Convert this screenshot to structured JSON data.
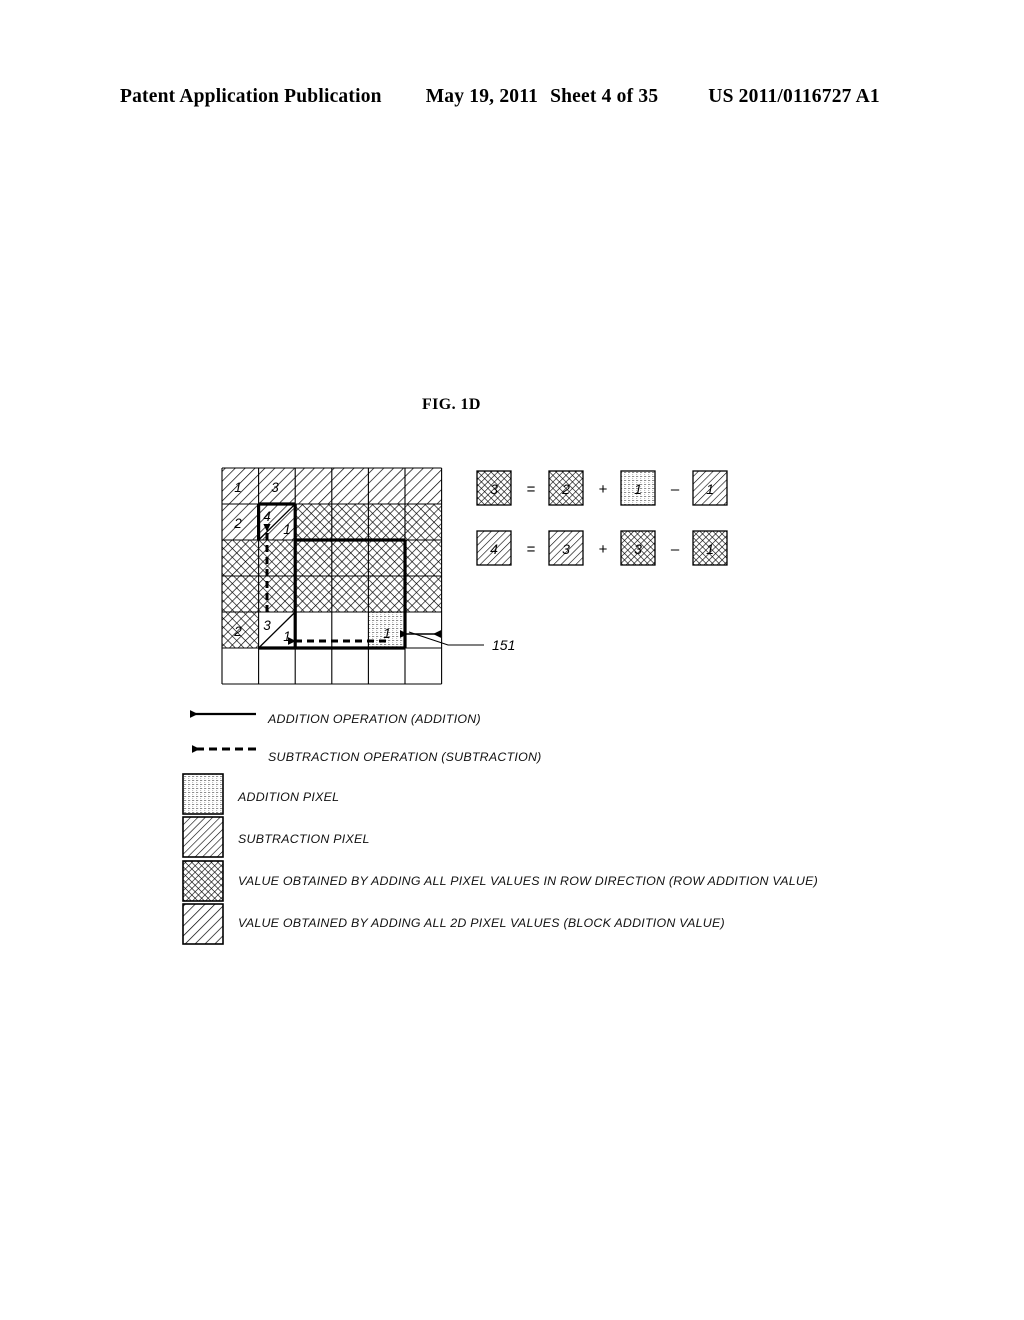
{
  "header": {
    "publication": "Patent Application Publication",
    "date": "May 19, 2011",
    "sheet": "Sheet 4 of 35",
    "patent_number": "US 2011/0116727 A1"
  },
  "figure": {
    "title": "FIG. 1D",
    "reference_label": "151",
    "grid": {
      "columns": 6,
      "rows": 6,
      "cells": [
        [
          {
            "fill": "diagonal",
            "value": "1"
          },
          {
            "fill": "diagonal",
            "value": "3"
          },
          {
            "fill": "diagonal",
            "value": ""
          },
          {
            "fill": "diagonal",
            "value": ""
          },
          {
            "fill": "diagonal",
            "value": ""
          },
          {
            "fill": "diagonal",
            "value": ""
          }
        ],
        [
          {
            "fill": "diagonal",
            "value": "2"
          },
          {
            "fill": "split-diagonal",
            "value": "4",
            "value2": "1"
          },
          {
            "fill": "crosshatch",
            "value": ""
          },
          {
            "fill": "crosshatch",
            "value": ""
          },
          {
            "fill": "crosshatch",
            "value": ""
          },
          {
            "fill": "crosshatch",
            "value": ""
          }
        ],
        [
          {
            "fill": "crosshatch",
            "value": ""
          },
          {
            "fill": "crosshatch",
            "value": ""
          },
          {
            "fill": "crosshatch",
            "value": ""
          },
          {
            "fill": "crosshatch",
            "value": ""
          },
          {
            "fill": "crosshatch",
            "value": ""
          },
          {
            "fill": "crosshatch",
            "value": ""
          }
        ],
        [
          {
            "fill": "crosshatch",
            "value": ""
          },
          {
            "fill": "crosshatch",
            "value": ""
          },
          {
            "fill": "crosshatch",
            "value": ""
          },
          {
            "fill": "crosshatch",
            "value": ""
          },
          {
            "fill": "crosshatch",
            "value": ""
          },
          {
            "fill": "crosshatch",
            "value": ""
          }
        ],
        [
          {
            "fill": "crosshatch",
            "value": "2"
          },
          {
            "fill": "split-diagonal",
            "value": "3",
            "value2": "1"
          },
          {
            "fill": "none",
            "value": ""
          },
          {
            "fill": "none",
            "value": ""
          },
          {
            "fill": "dots",
            "value": "1"
          },
          {
            "fill": "none",
            "value": ""
          }
        ],
        [
          {
            "fill": "none",
            "value": ""
          },
          {
            "fill": "none",
            "value": ""
          },
          {
            "fill": "none",
            "value": ""
          },
          {
            "fill": "none",
            "value": ""
          },
          {
            "fill": "none",
            "value": ""
          },
          {
            "fill": "none",
            "value": ""
          }
        ]
      ]
    },
    "equations": [
      {
        "result": {
          "value": "3",
          "fill": "crosshatch"
        },
        "eq": "=",
        "terms": [
          {
            "value": "2",
            "fill": "crosshatch"
          },
          {
            "op": "+",
            "value": "1",
            "fill": "dots"
          },
          {
            "op": "–",
            "value": "1",
            "fill": "diagonal"
          }
        ]
      },
      {
        "result": {
          "value": "4",
          "fill": "diagonal"
        },
        "eq": "=",
        "terms": [
          {
            "value": "3",
            "fill": "diagonal"
          },
          {
            "op": "+",
            "value": "3",
            "fill": "crosshatch"
          },
          {
            "op": "–",
            "value": "1",
            "fill": "crosshatch"
          }
        ]
      }
    ]
  },
  "legend": {
    "items": [
      {
        "mark": "solid-arrow",
        "label": "ADDITION OPERATION (ADDITION)"
      },
      {
        "mark": "dashed-arrow",
        "label": "SUBTRACTION OPERATION (SUBTRACTION)"
      },
      {
        "mark": "swatch-dots",
        "label": "ADDITION PIXEL"
      },
      {
        "mark": "swatch-diagonal",
        "label": "SUBTRACTION PIXEL"
      },
      {
        "mark": "swatch-crosshatch",
        "label": "VALUE OBTAINED BY ADDING ALL PIXEL VALUES IN ROW DIRECTION (ROW ADDITION VALUE)"
      },
      {
        "mark": "swatch-diagonal-wide",
        "label": "VALUE OBTAINED BY ADDING ALL 2D PIXEL VALUES (BLOCK ADDITION VALUE)"
      }
    ]
  },
  "colors": {
    "ink": "#000000",
    "paper": "#ffffff"
  }
}
